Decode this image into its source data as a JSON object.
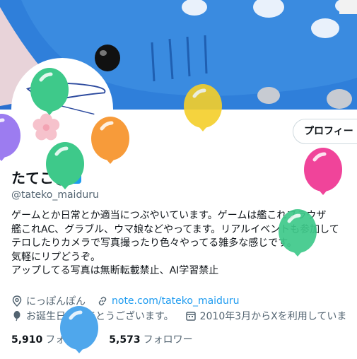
{
  "profile": {
    "edit_button_label": "プロフィー",
    "display_name": "たてこ@",
    "handle": "@tateko_maiduru",
    "bio_lines": [
      "ゲームとか日常とか適当につぶやいています。ゲームは艦これブラウザ",
      "艦これAC、グラブル、ウマ娘などやってます。リアルイベントも参加して",
      "テロしたりカメラで写真撮ったり色々やってる雑多な感じです。",
      "気軽にリプどうぞ。",
      "アップしてる写真は無断転載禁止、AI学習禁止"
    ],
    "location": "にっぽんぽん",
    "website": "note.com/tateko_maiduru",
    "birthday": "お誕生日おめでとうございます。",
    "joined": "2010年3月からXを利用していま",
    "following_count": "5,910",
    "following_label": "フォロー中",
    "followers_count": "5,573",
    "followers_label": "フォロワー"
  },
  "colors": {
    "accent": "#1d9bf0",
    "secondary_text": "#536471",
    "balloon_green": "#3ec98a",
    "balloon_yellow": "#f5cf2a",
    "balloon_orange": "#f79b3a",
    "balloon_pink": "#f0449a",
    "balloon_purple": "#9c7cf0",
    "balloon_blue": "#4fa7ec"
  },
  "icons": {
    "location": "location-pin-icon",
    "link": "link-icon",
    "birthday": "balloon-icon",
    "joined": "calendar-icon",
    "verified": "verified-badge-icon"
  }
}
